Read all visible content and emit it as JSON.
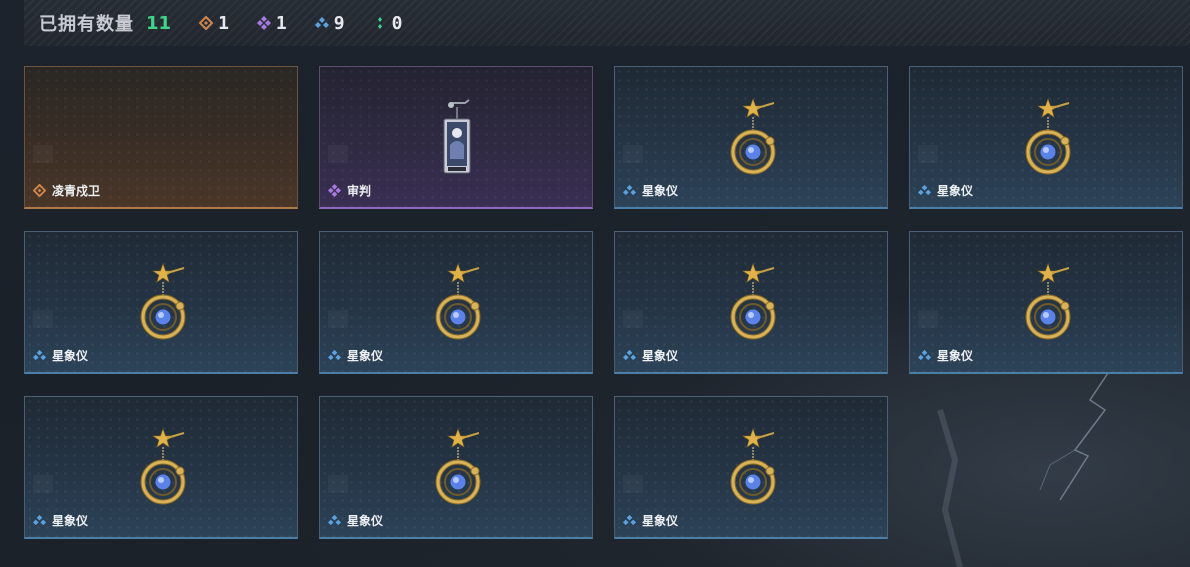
{
  "header": {
    "title": "已拥有数量",
    "total": "11",
    "rarities": [
      {
        "name": "orange",
        "color": "#d3874a",
        "icon": "orange-diamond-icon",
        "count": "1"
      },
      {
        "name": "purple",
        "color": "#a879e0",
        "icon": "purple-clover-icon",
        "count": "1"
      },
      {
        "name": "blue",
        "color": "#5aa2e0",
        "icon": "blue-triple-diamond-icon",
        "count": "9"
      },
      {
        "name": "green",
        "color": "#3fd487",
        "icon": "green-dots-icon",
        "count": "0"
      }
    ]
  },
  "items": [
    {
      "name": "凌青戍卫",
      "rarity": "orange",
      "art": "none"
    },
    {
      "name": "审判",
      "rarity": "purple",
      "art": "card-charm-icon"
    },
    {
      "name": "星象仪",
      "rarity": "blue",
      "art": "astrolabe-charm-icon"
    },
    {
      "name": "星象仪",
      "rarity": "blue",
      "art": "astrolabe-charm-icon"
    },
    {
      "name": "星象仪",
      "rarity": "blue",
      "art": "astrolabe-charm-icon"
    },
    {
      "name": "星象仪",
      "rarity": "blue",
      "art": "astrolabe-charm-icon"
    },
    {
      "name": "星象仪",
      "rarity": "blue",
      "art": "astrolabe-charm-icon"
    },
    {
      "name": "星象仪",
      "rarity": "blue",
      "art": "astrolabe-charm-icon"
    },
    {
      "name": "星象仪",
      "rarity": "blue",
      "art": "astrolabe-charm-icon"
    },
    {
      "name": "星象仪",
      "rarity": "blue",
      "art": "astrolabe-charm-icon"
    },
    {
      "name": "星象仪",
      "rarity": "blue",
      "art": "astrolabe-charm-icon"
    }
  ]
}
